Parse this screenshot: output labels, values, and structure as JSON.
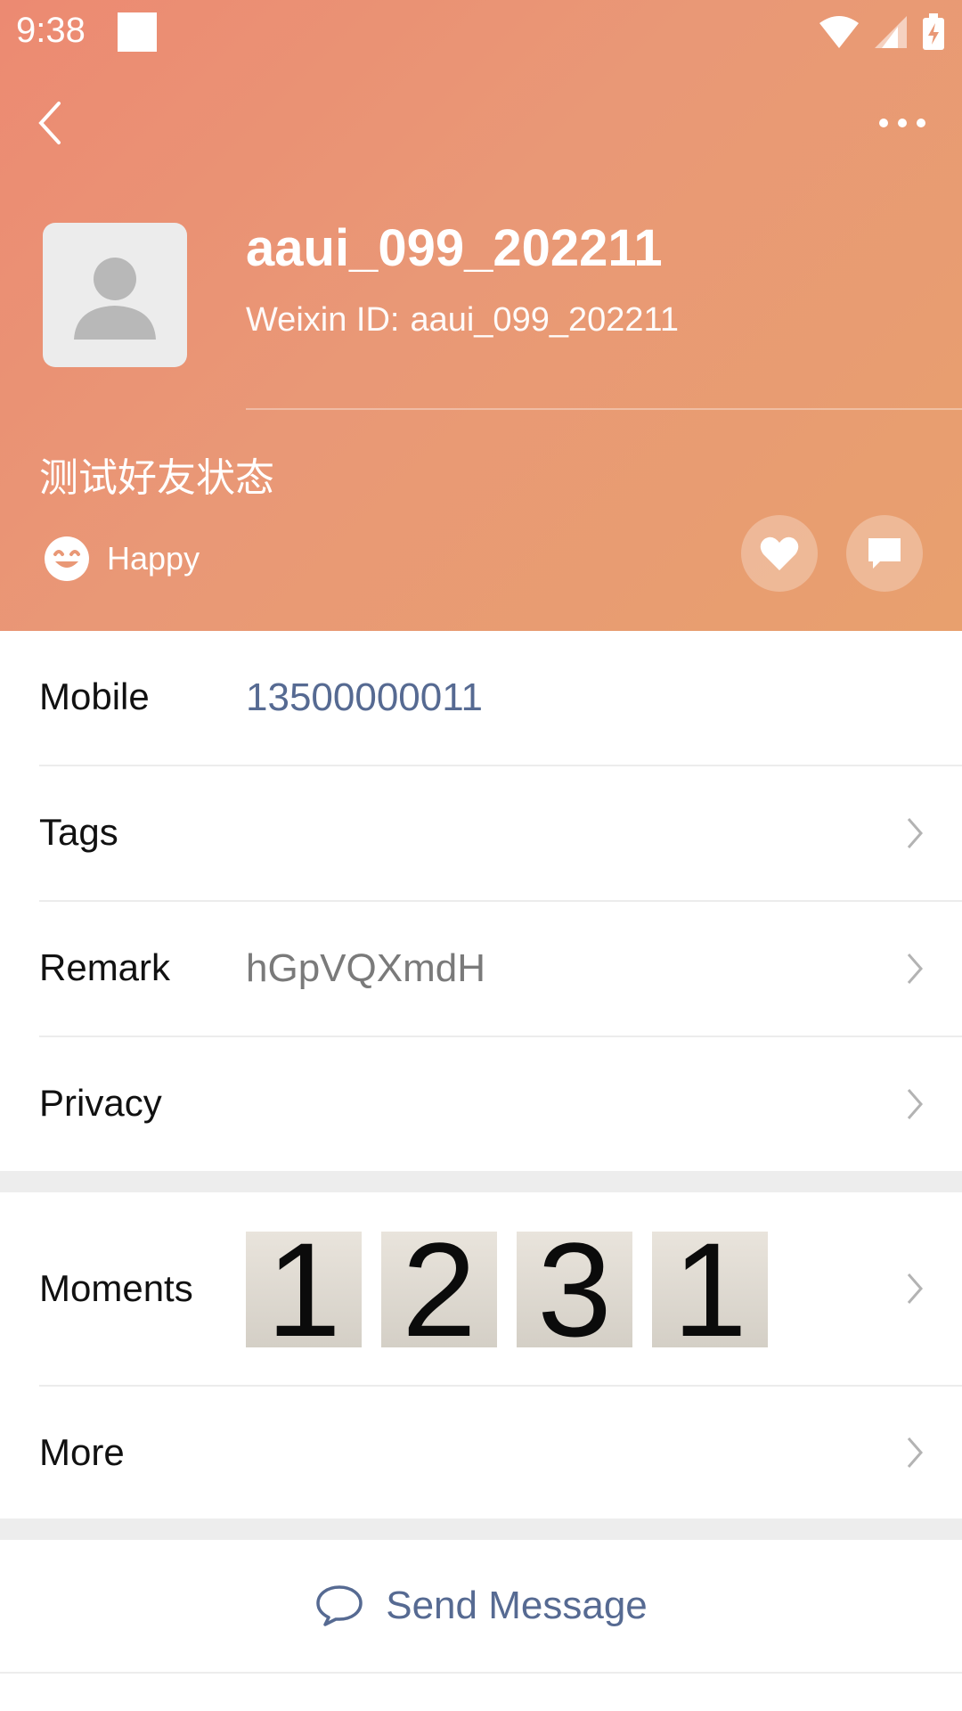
{
  "status_bar": {
    "time": "9:38"
  },
  "profile": {
    "name": "aaui_099_202211",
    "weixin_id_label": "Weixin ID:",
    "weixin_id": "aaui_099_202211",
    "status": "测试好友状态",
    "mood": "Happy"
  },
  "rows": {
    "mobile": {
      "label": "Mobile",
      "value": "13500000011"
    },
    "tags": {
      "label": "Tags"
    },
    "remark": {
      "label": "Remark",
      "value": "hGpVQXmdH"
    },
    "privacy": {
      "label": "Privacy"
    },
    "moments": {
      "label": "Moments",
      "thumbs": [
        "1",
        "2",
        "3",
        "1"
      ]
    },
    "more": {
      "label": "More"
    }
  },
  "actions": {
    "send_message": "Send Message"
  },
  "colors": {
    "header_gradient_start": "#ec8a72",
    "header_gradient_end": "#e8a06e",
    "link_blue": "#566a92",
    "value_gray": "#7a7a7a"
  },
  "icons": [
    "back-arrow-icon",
    "more-dots-icon",
    "avatar-placeholder-icon",
    "smiley-icon",
    "heart-icon",
    "chat-bubble-icon",
    "chevron-right-icon",
    "wifi-icon",
    "signal-icon",
    "battery-icon"
  ]
}
